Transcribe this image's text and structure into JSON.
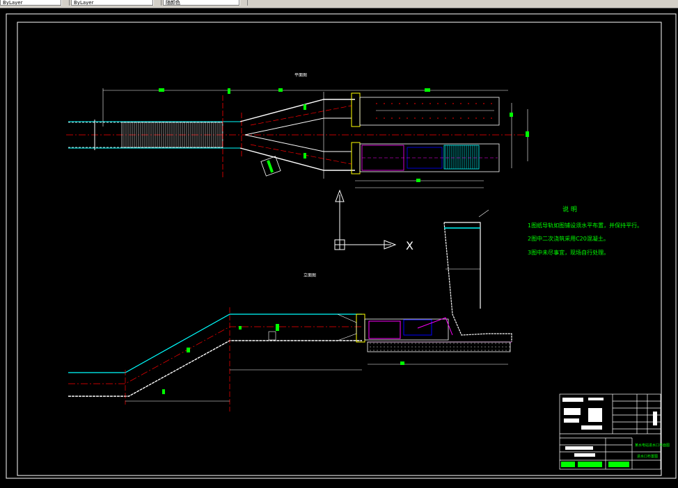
{
  "toolbar": {
    "layer_combo": "ByLayer",
    "linetype_combo": "ByLayer",
    "lineweight_combo": "随颜色"
  },
  "drawing": {
    "plan_title": "平面图",
    "elevation_title": "立面图",
    "notes_title": "说 明",
    "notes": [
      "1图纸导轨如图铺设须水平布置，并保持平行。",
      "2图中二次浇筑采用C20混凝土。",
      "3图中未尽事宜，现场自行处理。"
    ],
    "ucs_x_label": "X",
    "title_block_name": "某水电站进水口平面图",
    "title_block_sub": "进水口布置图"
  },
  "colors": {
    "background": "#000000",
    "frame": "#ffffff",
    "notes": "#00ff00",
    "centerline": "#ff0000",
    "water": "#00ffff",
    "gate": "#ff00ff",
    "dimension": "#00ff00"
  }
}
